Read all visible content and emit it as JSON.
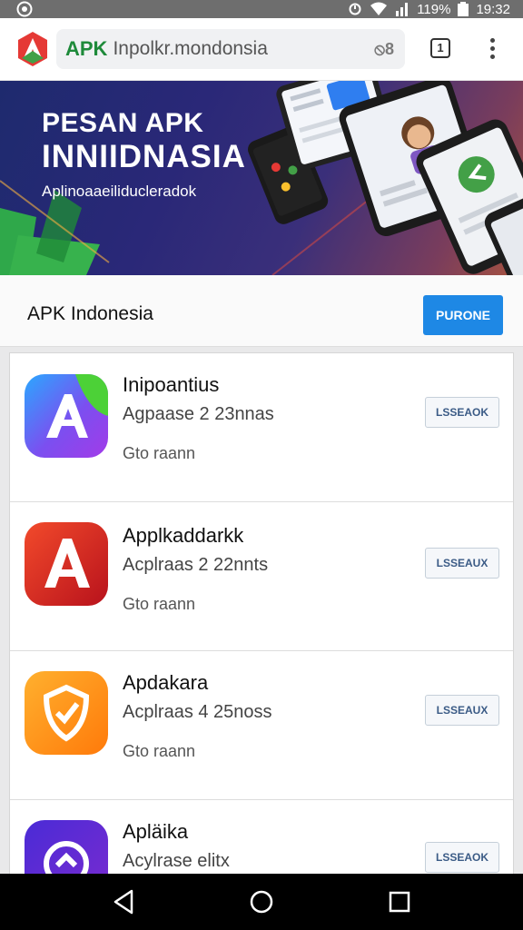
{
  "status_bar": {
    "battery": "119%",
    "time": "19:32",
    "icons": [
      "app-notification-icon",
      "alarm-icon",
      "wifi-icon",
      "signal-icon",
      "battery-icon"
    ]
  },
  "browser": {
    "url_strong": "APK",
    "url_rest": "Inpolkr.mondonsia",
    "url_action": "⦸8",
    "tab_count": "1",
    "icons": [
      "site-logo-icon",
      "more-vert-icon"
    ]
  },
  "banner": {
    "line1": "PESAN APK",
    "line2": "INNIIDNASIA",
    "line3": "Aplinoaaeiliducleradok"
  },
  "header": {
    "title": "APK Indonesia",
    "button": "PURONE"
  },
  "apps": [
    {
      "name": "Inipoantius",
      "subtitle": "Agpaase 2 23nnas",
      "meta": "Gto raann",
      "button": "LSSEAOK",
      "icon": "gradient-letter-a-icon",
      "colors": [
        "#2aa8ff",
        "#a23be8",
        "#4cd137"
      ]
    },
    {
      "name": "Applkaddarkk",
      "subtitle": "Acplraas 2 22nnts",
      "meta": "Gto raann",
      "button": "LSSEAUX",
      "icon": "red-letter-a-icon",
      "colors": [
        "#f24a2b",
        "#b8121c"
      ]
    },
    {
      "name": "Apdakara",
      "subtitle": "Acplraas 4 25noss",
      "meta": "Gto raann",
      "button": "LSSEAUX",
      "icon": "shield-icon",
      "colors": [
        "#ffb02e",
        "#ff7a0a"
      ]
    },
    {
      "name": "Apläika",
      "subtitle": "Acylrase elitx",
      "meta": "",
      "button": "LSSEAOK",
      "icon": "circle-arrow-icon",
      "colors": [
        "#4a2bd6",
        "#7a2bd0"
      ]
    }
  ],
  "nav": {
    "icons": [
      "back-icon",
      "home-icon",
      "recents-icon"
    ]
  }
}
